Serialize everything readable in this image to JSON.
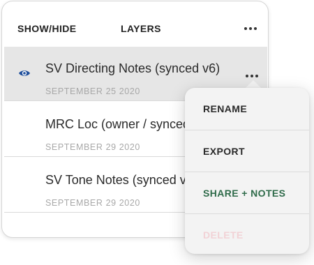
{
  "header": {
    "tab_show_hide": "SHOW/HIDE",
    "tab_layers": "LAYERS"
  },
  "layers": [
    {
      "title": "SV Directing Notes (synced v6)",
      "date": "SEPTEMBER 25 2020",
      "visible": true,
      "selected": true
    },
    {
      "title": "MRC Loc (owner / synced v1)",
      "date": "SEPTEMBER 29 2020",
      "visible": false,
      "selected": false
    },
    {
      "title": "SV Tone Notes (synced v3)",
      "date": "SEPTEMBER 29 2020",
      "visible": false,
      "selected": false
    }
  ],
  "menu": {
    "rename": "RENAME",
    "export": "EXPORT",
    "share_notes": "SHARE + NOTES",
    "delete": "DELETE"
  },
  "colors": {
    "eye_icon": "#1f4f9c",
    "share_notes": "#2f6b4a",
    "delete_disabled": "#f2d2d6",
    "selected_row": "#e6e6e6"
  },
  "icons": {
    "visibility": "eye-icon",
    "more": "more-dots-icon"
  }
}
